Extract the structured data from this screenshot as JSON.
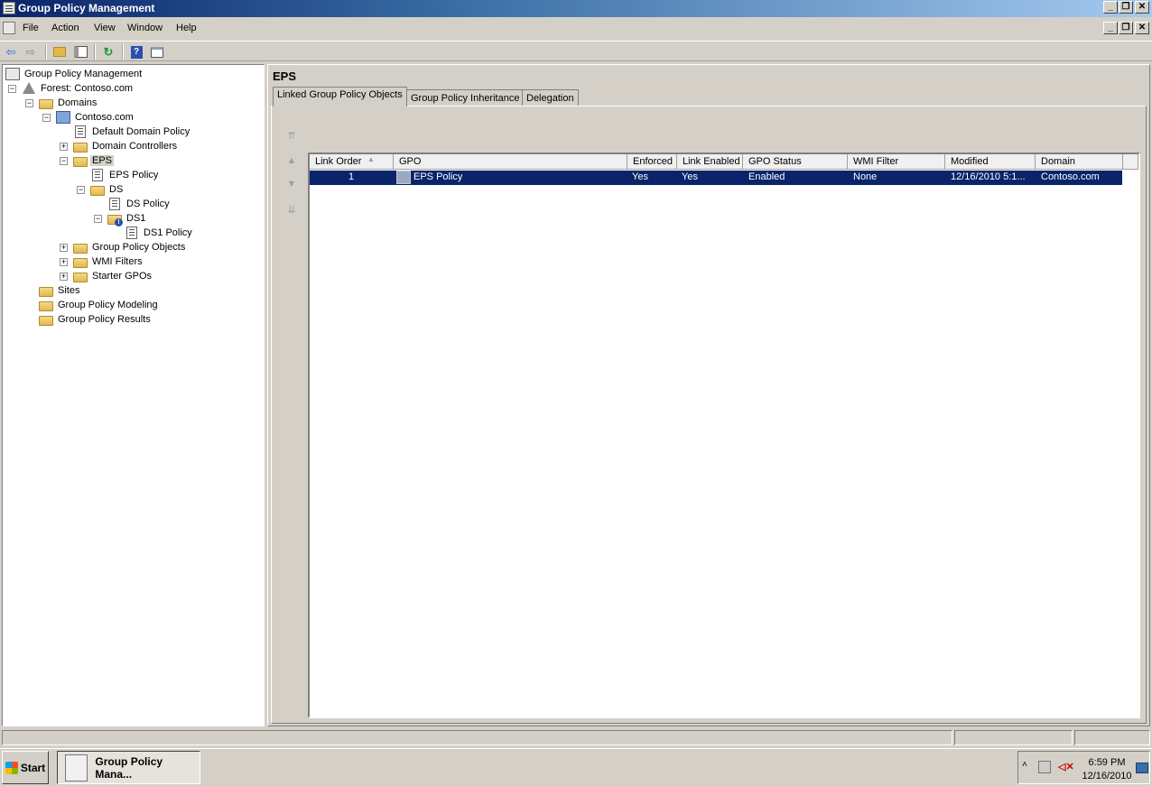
{
  "window": {
    "title": "Group Policy Management",
    "controls": [
      "_",
      "❐",
      "✕"
    ]
  },
  "menu": {
    "items": [
      "File",
      "Action",
      "View",
      "Window",
      "Help"
    ],
    "mdi_controls": [
      "_",
      "❐",
      "✕"
    ]
  },
  "toolbar": {
    "buttons": [
      "back-icon",
      "forward-icon",
      "up-folder-icon",
      "show-hide-tree-icon",
      "refresh-icon",
      "help-icon",
      "properties-icon"
    ]
  },
  "tree": {
    "root": "Group Policy Management",
    "forest": "Forest: Contoso.com",
    "domains": "Domains",
    "domain": "Contoso.com",
    "default_policy": "Default Domain Policy",
    "domain_controllers": "Domain Controllers",
    "eps": "EPS",
    "eps_policy": "EPS Policy",
    "ds": "DS",
    "ds_policy": "DS Policy",
    "ds1": "DS1",
    "ds1_policy": "DS1 Policy",
    "gpo_objects": "Group Policy Objects",
    "wmi_filters": "WMI Filters",
    "starter_gpos": "Starter GPOs",
    "sites": "Sites",
    "modeling": "Group Policy Modeling",
    "results": "Group Policy Results",
    "expanders": {
      "minus": "−",
      "plus": "+"
    }
  },
  "details": {
    "title": "EPS",
    "tabs": [
      "Linked Group Policy Objects",
      "Group Policy Inheritance",
      "Delegation"
    ],
    "active_tab": "Linked Group Policy Objects",
    "order_arrows": [
      "⇈",
      "▲",
      "▼",
      "⇊"
    ],
    "columns": [
      "Link Order",
      "GPO",
      "Enforced",
      "Link Enabled",
      "GPO Status",
      "WMI Filter",
      "Modified",
      "Domain"
    ],
    "sort_indicator": "▲",
    "rows": [
      {
        "link_order": "1",
        "gpo": "EPS Policy",
        "enforced": "Yes",
        "link_enabled": "Yes",
        "gpo_status": "Enabled",
        "wmi_filter": "None",
        "modified": "12/16/2010 5:1...",
        "domain": "Contoso.com"
      }
    ]
  },
  "taskbar": {
    "start": "Start",
    "task": "Group Policy Mana...",
    "time": "6:59 PM",
    "date": "12/16/2010"
  },
  "colors": {
    "selection": "#0a246a",
    "title_start": "#0a246a",
    "title_end": "#a6caf0"
  }
}
